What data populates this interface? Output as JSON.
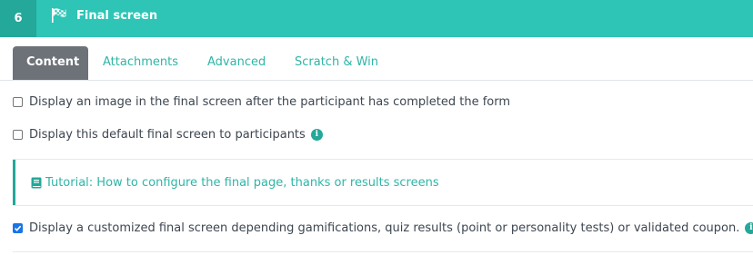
{
  "header": {
    "step_number": "6",
    "title": "Final screen",
    "icon": "checkered-flag-icon",
    "accent_color": "#2ec4b6"
  },
  "tabs": [
    {
      "label": "Content",
      "active": true
    },
    {
      "label": "Attachments",
      "active": false
    },
    {
      "label": "Advanced",
      "active": false
    },
    {
      "label": "Scratch & Win",
      "active": false
    }
  ],
  "options": {
    "display_image": {
      "label": "Display an image in the final screen after the participant has completed the form",
      "checked": false
    },
    "display_default": {
      "label": "Display this default final screen to participants",
      "checked": false
    },
    "display_customized": {
      "label": "Display a customized final screen depending gamifications, quiz results (point or personality tests) or validated coupon.",
      "checked": true
    }
  },
  "tutorial": {
    "text": "Tutorial: How to configure the final page, thanks or results screens",
    "icon": "book-icon"
  },
  "info_icon_glyph": "i"
}
